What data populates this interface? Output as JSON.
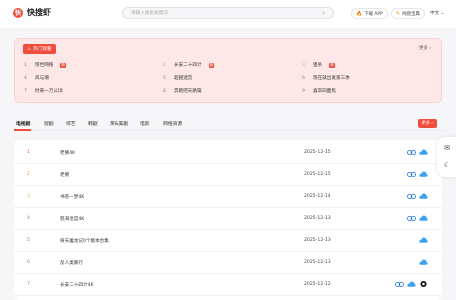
{
  "header": {
    "logo_glyph": "快",
    "app_name": "快搜虾",
    "search_placeholder": "请输入搜索关键词",
    "download_label": "下载 APP",
    "vip_label": "网盘宝典",
    "language": "中文"
  },
  "hot": {
    "badge": "热门观看",
    "more": "更多",
    "items": [
      {
        "rank": "1",
        "title": "惊世网络",
        "tag": "新"
      },
      {
        "rank": "2",
        "title": "长安二十四计",
        "tag": "新"
      },
      {
        "rank": "3",
        "title": "狙杀",
        "tag": "新"
      },
      {
        "rank": "4",
        "title": "风与潮",
        "tag": ""
      },
      {
        "rank": "5",
        "title": "超越迷宫",
        "tag": ""
      },
      {
        "rank": "6",
        "title": "现在就出发第三季",
        "tag": ""
      },
      {
        "rank": "7",
        "title": "时来一万公顷",
        "tag": ""
      },
      {
        "rank": "8",
        "title": "奔跑吧天路篇",
        "tag": ""
      },
      {
        "rank": "9",
        "title": "喜卒四面焦",
        "tag": ""
      }
    ]
  },
  "tabs": {
    "items": [
      "电视剧",
      "短剧",
      "综艺",
      "韩剧",
      "英&美剧",
      "电影",
      "网络资源"
    ],
    "more": "更多"
  },
  "list": {
    "rows": [
      {
        "rank": "1",
        "title": "老舅4K",
        "date": "2025-12-15",
        "icons": [
          "baidu",
          "cloud"
        ]
      },
      {
        "rank": "2",
        "title": "老舅",
        "date": "2025-12-15",
        "icons": [
          "baidu",
          "cloud"
        ]
      },
      {
        "rank": "3",
        "title": "书卷一梦4K",
        "date": "2025-12-14",
        "icons": [
          "baidu",
          "cloud"
        ]
      },
      {
        "rank": "4",
        "title": "怒海沧官4K",
        "date": "2025-12-13",
        "icons": [
          "baidu",
          "cloud"
        ]
      },
      {
        "rank": "5",
        "title": "倚天屠龙记0个版本合集",
        "date": "2025-12-13",
        "icons": [
          "cloud"
        ]
      },
      {
        "rank": "6",
        "title": "反人类暴行",
        "date": "2025-12-13",
        "icons": [
          "cloud"
        ]
      },
      {
        "rank": "7",
        "title": "长安二十四计4K",
        "date": "2025-12-12",
        "icons": [
          "baidu",
          "cloud",
          "quark"
        ]
      }
    ]
  },
  "colors": {
    "accent": "#ef4e3d",
    "rank_2": "#f0943a",
    "rank_3": "#e3b735",
    "baidu_blue": "#2b7de0",
    "cloud_blue": "#3ea0f0"
  }
}
